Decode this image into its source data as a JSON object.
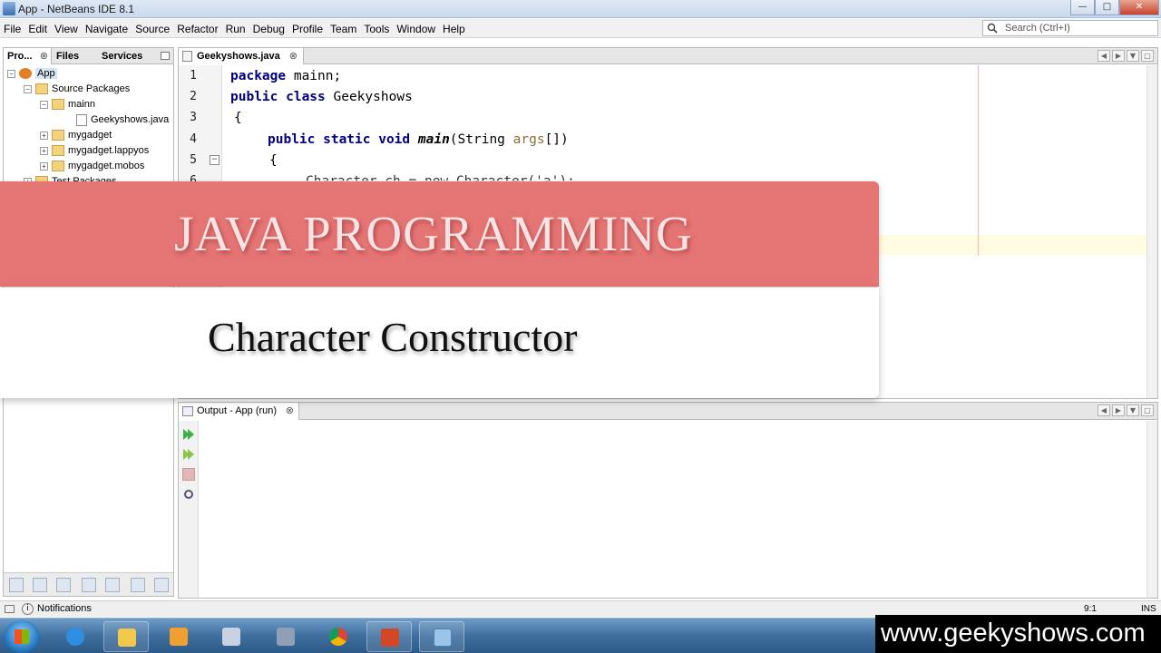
{
  "window": {
    "title": "App - NetBeans IDE 8.1"
  },
  "menu": [
    "File",
    "Edit",
    "View",
    "Navigate",
    "Source",
    "Refactor",
    "Run",
    "Debug",
    "Profile",
    "Team",
    "Tools",
    "Window",
    "Help"
  ],
  "search": {
    "placeholder": "Search (Ctrl+I)"
  },
  "left_panel": {
    "tabs": [
      "Pro...",
      "Files",
      "Services"
    ],
    "tree": [
      "App",
      "Source Packages",
      "mainn",
      "Geekyshows.java",
      "mygadget",
      "mygadget.lappyos",
      "mygadget.mobos",
      "Test Packages"
    ]
  },
  "editor": {
    "tab": "Geekyshows.java",
    "line_numbers": [
      "1",
      "2",
      "3",
      "4",
      "5",
      "6"
    ],
    "code": {
      "l1_kw": "package",
      "l1_rest": " mainn;",
      "l2_kw": "public class",
      "l2_rest": " Geekyshows",
      "l3": "{",
      "l4_kw": "public static void",
      "l4_main": "main",
      "l4_open": "(String ",
      "l4_args": "args",
      "l4_close": "[])",
      "l5": "{",
      "l6": "Character ch = new Character('a');"
    }
  },
  "output": {
    "tab": "Output - App (run)"
  },
  "status": {
    "notifications": "Notifications",
    "position": "9:1",
    "mode": "INS"
  },
  "banner": {
    "title": "JAVA PROGRAMMING",
    "subtitle": "Character Constructor"
  },
  "watermark": "www.geekyshows.com",
  "colors": {
    "banner": "#e57474",
    "keyword": "#000080",
    "taskbar": "#3e6f9f"
  }
}
